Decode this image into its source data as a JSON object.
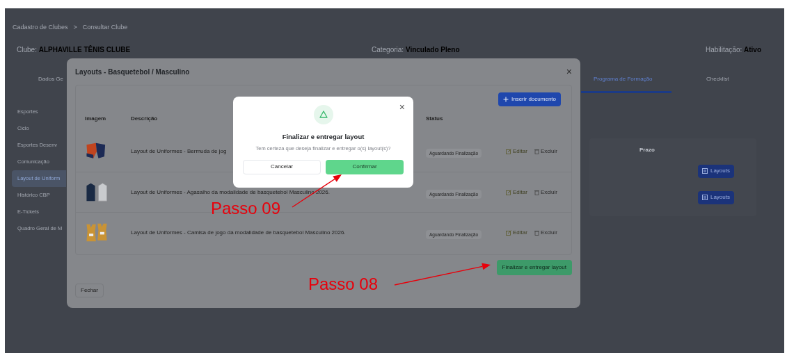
{
  "page": {
    "breadcrumb": [
      "Cadastro de Clubes",
      "Consultar Clube"
    ],
    "breadcrumb_separator": ">",
    "info": [
      {
        "label": "Clube:",
        "value": "ALPHAVILLE TÊNIS CLUBE"
      },
      {
        "label": "Categoria:",
        "value": "Vinculado Pleno"
      },
      {
        "label": "Habilitação:",
        "value": "Ativo"
      }
    ],
    "tabs": [
      {
        "label": "Dados Ge",
        "selected": false
      },
      {
        "label": "Programa de Formação",
        "selected": true
      },
      {
        "label": "Checklist",
        "selected": false
      }
    ],
    "sidebar": [
      {
        "label": "Esportes",
        "selected": false
      },
      {
        "label": "Ciclo",
        "selected": false
      },
      {
        "label": "Esportes Desenv",
        "selected": false
      },
      {
        "label": "Comunicação",
        "selected": false
      },
      {
        "label": "Layout de Uniform",
        "selected": true
      },
      {
        "label": "Histórico CBP",
        "selected": false
      },
      {
        "label": "E-Tickets",
        "selected": false
      },
      {
        "label": "Quadro Geral de M",
        "selected": false
      }
    ],
    "table_header": "Prazo",
    "row_buttons": [
      "Layouts",
      "Layouts"
    ]
  },
  "layouts_modal": {
    "title": "Layouts - Basquetebol / Masculino",
    "close": "×",
    "insert_button": "Inserir documento",
    "columns": [
      "Imagem",
      "Descrição",
      "Status"
    ],
    "rows": [
      {
        "kind": "shorts",
        "description": "Layout de Uniformes - Bermuda de jog",
        "status": "Aguardando Finalização",
        "edit": "Editar",
        "delete": "Excluir"
      },
      {
        "kind": "jacket",
        "description": "Layout de Uniformes - Agasalho da modalidade de basquetebol Masculino 2026.",
        "status": "Aguardando Finalização",
        "edit": "Editar",
        "delete": "Excluir"
      },
      {
        "kind": "jersey",
        "description": "Layout de Uniformes - Camisa de jogo da modalidade de basquetebol Masculino 2026.",
        "status": "Aguardando Finalização",
        "edit": "Editar",
        "delete": "Excluir"
      }
    ],
    "finalize_button": "Finalizar e entregar layout",
    "close_button": "Fechar"
  },
  "confirm_dialog": {
    "close": "×",
    "title": "Finalizar e entregar layout",
    "message": "Tem certeza que deseja finalizar e entregar o(s) layout(s)?",
    "cancel": "Cancelar",
    "confirm": "Confirmar"
  },
  "annotations": [
    "Passo 09",
    "Passo 08"
  ]
}
